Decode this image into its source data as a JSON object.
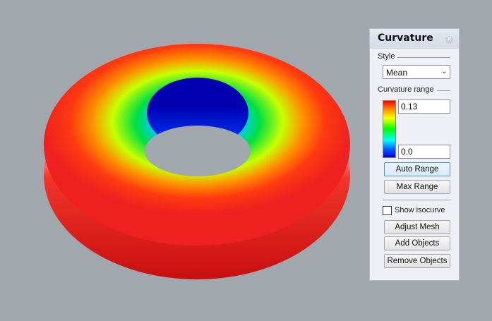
{
  "panel": {
    "title": "Curvature",
    "close_icon": "close-icon",
    "style_label": "Style",
    "style_value": "Mean",
    "range_label": "Curvature range",
    "range_max": "0.13",
    "range_min": "0.0",
    "auto_range_label": "Auto Range",
    "max_range_label": "Max Range",
    "show_isocurve_label": "Show isocurve",
    "show_isocurve_checked": false,
    "adjust_mesh_label": "Adjust Mesh",
    "add_objects_label": "Add Objects",
    "remove_objects_label": "Remove Objects"
  },
  "colors": {
    "viewport_bg": "#a2a6ad",
    "curvature_high": "#ff0000",
    "curvature_mid": "#00ff00",
    "curvature_low": "#0000e0"
  }
}
